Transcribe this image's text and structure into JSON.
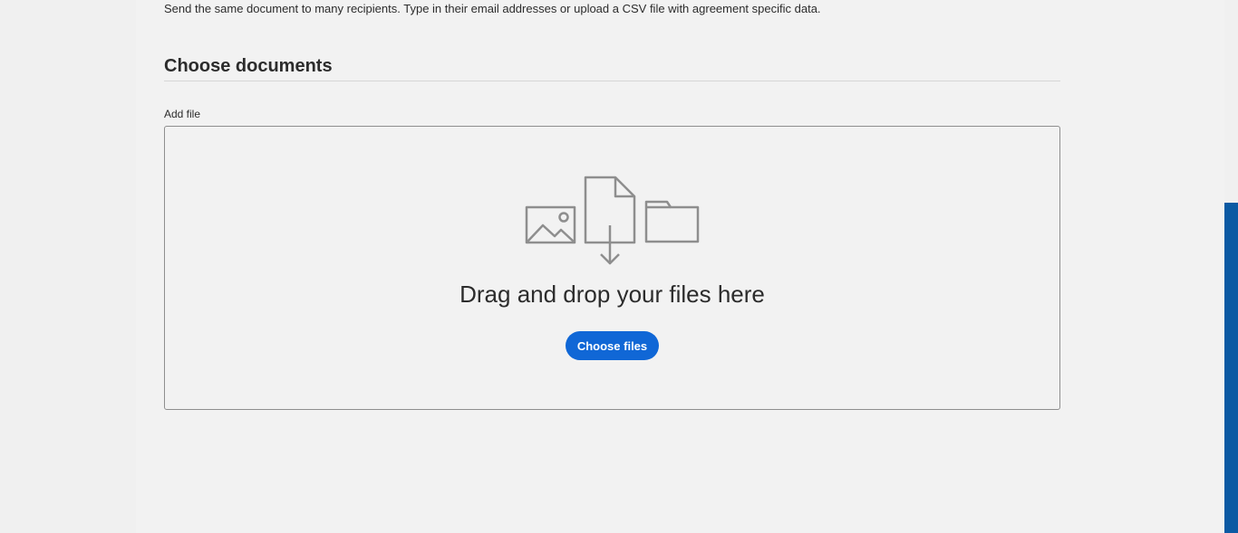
{
  "intro": {
    "description": "Send the same document to many recipients. Type in their email addresses or upload a CSV file with agreement specific data."
  },
  "documents": {
    "title": "Choose documents",
    "add_file_label": "Add file",
    "drop_zone": {
      "icons": [
        "image-icon",
        "file-download-icon",
        "folder-icon"
      ],
      "message": "Drag and drop your files here",
      "button_label": "Choose files"
    }
  },
  "colors": {
    "accent": "#1067d6",
    "side_bar": "#0b5aa3",
    "icon_stroke": "#8e8e8e",
    "background": "#f2f2f2"
  }
}
